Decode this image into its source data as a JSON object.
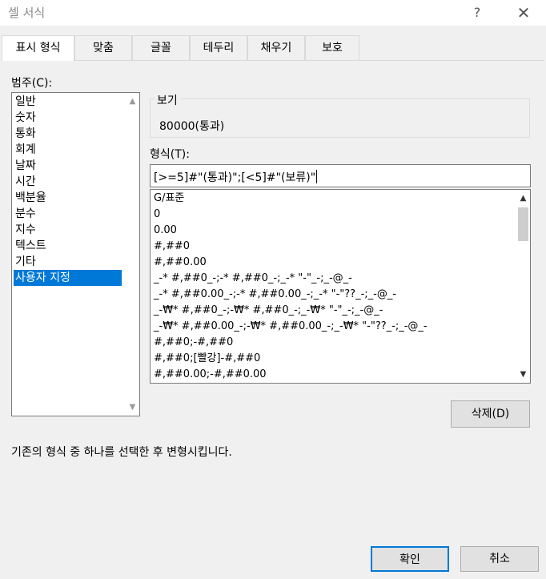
{
  "window": {
    "title": "셀 서식",
    "help": "?",
    "close": "✕"
  },
  "tabs": [
    {
      "label": "표시 형식",
      "active": true
    },
    {
      "label": "맞춤"
    },
    {
      "label": "글꼴"
    },
    {
      "label": "테두리"
    },
    {
      "label": "채우기"
    },
    {
      "label": "보호"
    }
  ],
  "category": {
    "label": "범주(C):",
    "items": [
      "일반",
      "숫자",
      "통화",
      "회계",
      "날짜",
      "시간",
      "백분율",
      "분수",
      "지수",
      "텍스트",
      "기타",
      "사용자 지정"
    ],
    "selected": "사용자 지정"
  },
  "preview": {
    "title": "보기",
    "value": "80000(통과)"
  },
  "format": {
    "label": "형식(T):",
    "value": "[>=5]#\"(통과)\";[<5]#\"(보류)\"",
    "list": [
      "G/표준",
      "0",
      "0.00",
      "#,##0",
      "#,##0.00",
      "_-* #,##0_-;-* #,##0_-;_-* \"-\"_-;_-@_-",
      "_-* #,##0.00_-;-* #,##0.00_-;_-* \"-\"??_-;_-@_-",
      "_-₩* #,##0_-;-₩* #,##0_-;_-₩* \"-\"_-;_-@_-",
      "_-₩* #,##0.00_-;-₩* #,##0.00_-;_-₩* \"-\"??_-;_-@_-",
      "#,##0;-#,##0",
      "#,##0;[빨강]-#,##0",
      "#,##0.00;-#,##0.00"
    ]
  },
  "buttons": {
    "delete": "삭제(D)",
    "ok": "확인",
    "cancel": "취소"
  },
  "description": "기존의 형식 중 하나를 선택한 후 변형시킵니다.",
  "colors": {
    "selection": "#0078d7",
    "dialog_bg": "#f0f0f0"
  }
}
